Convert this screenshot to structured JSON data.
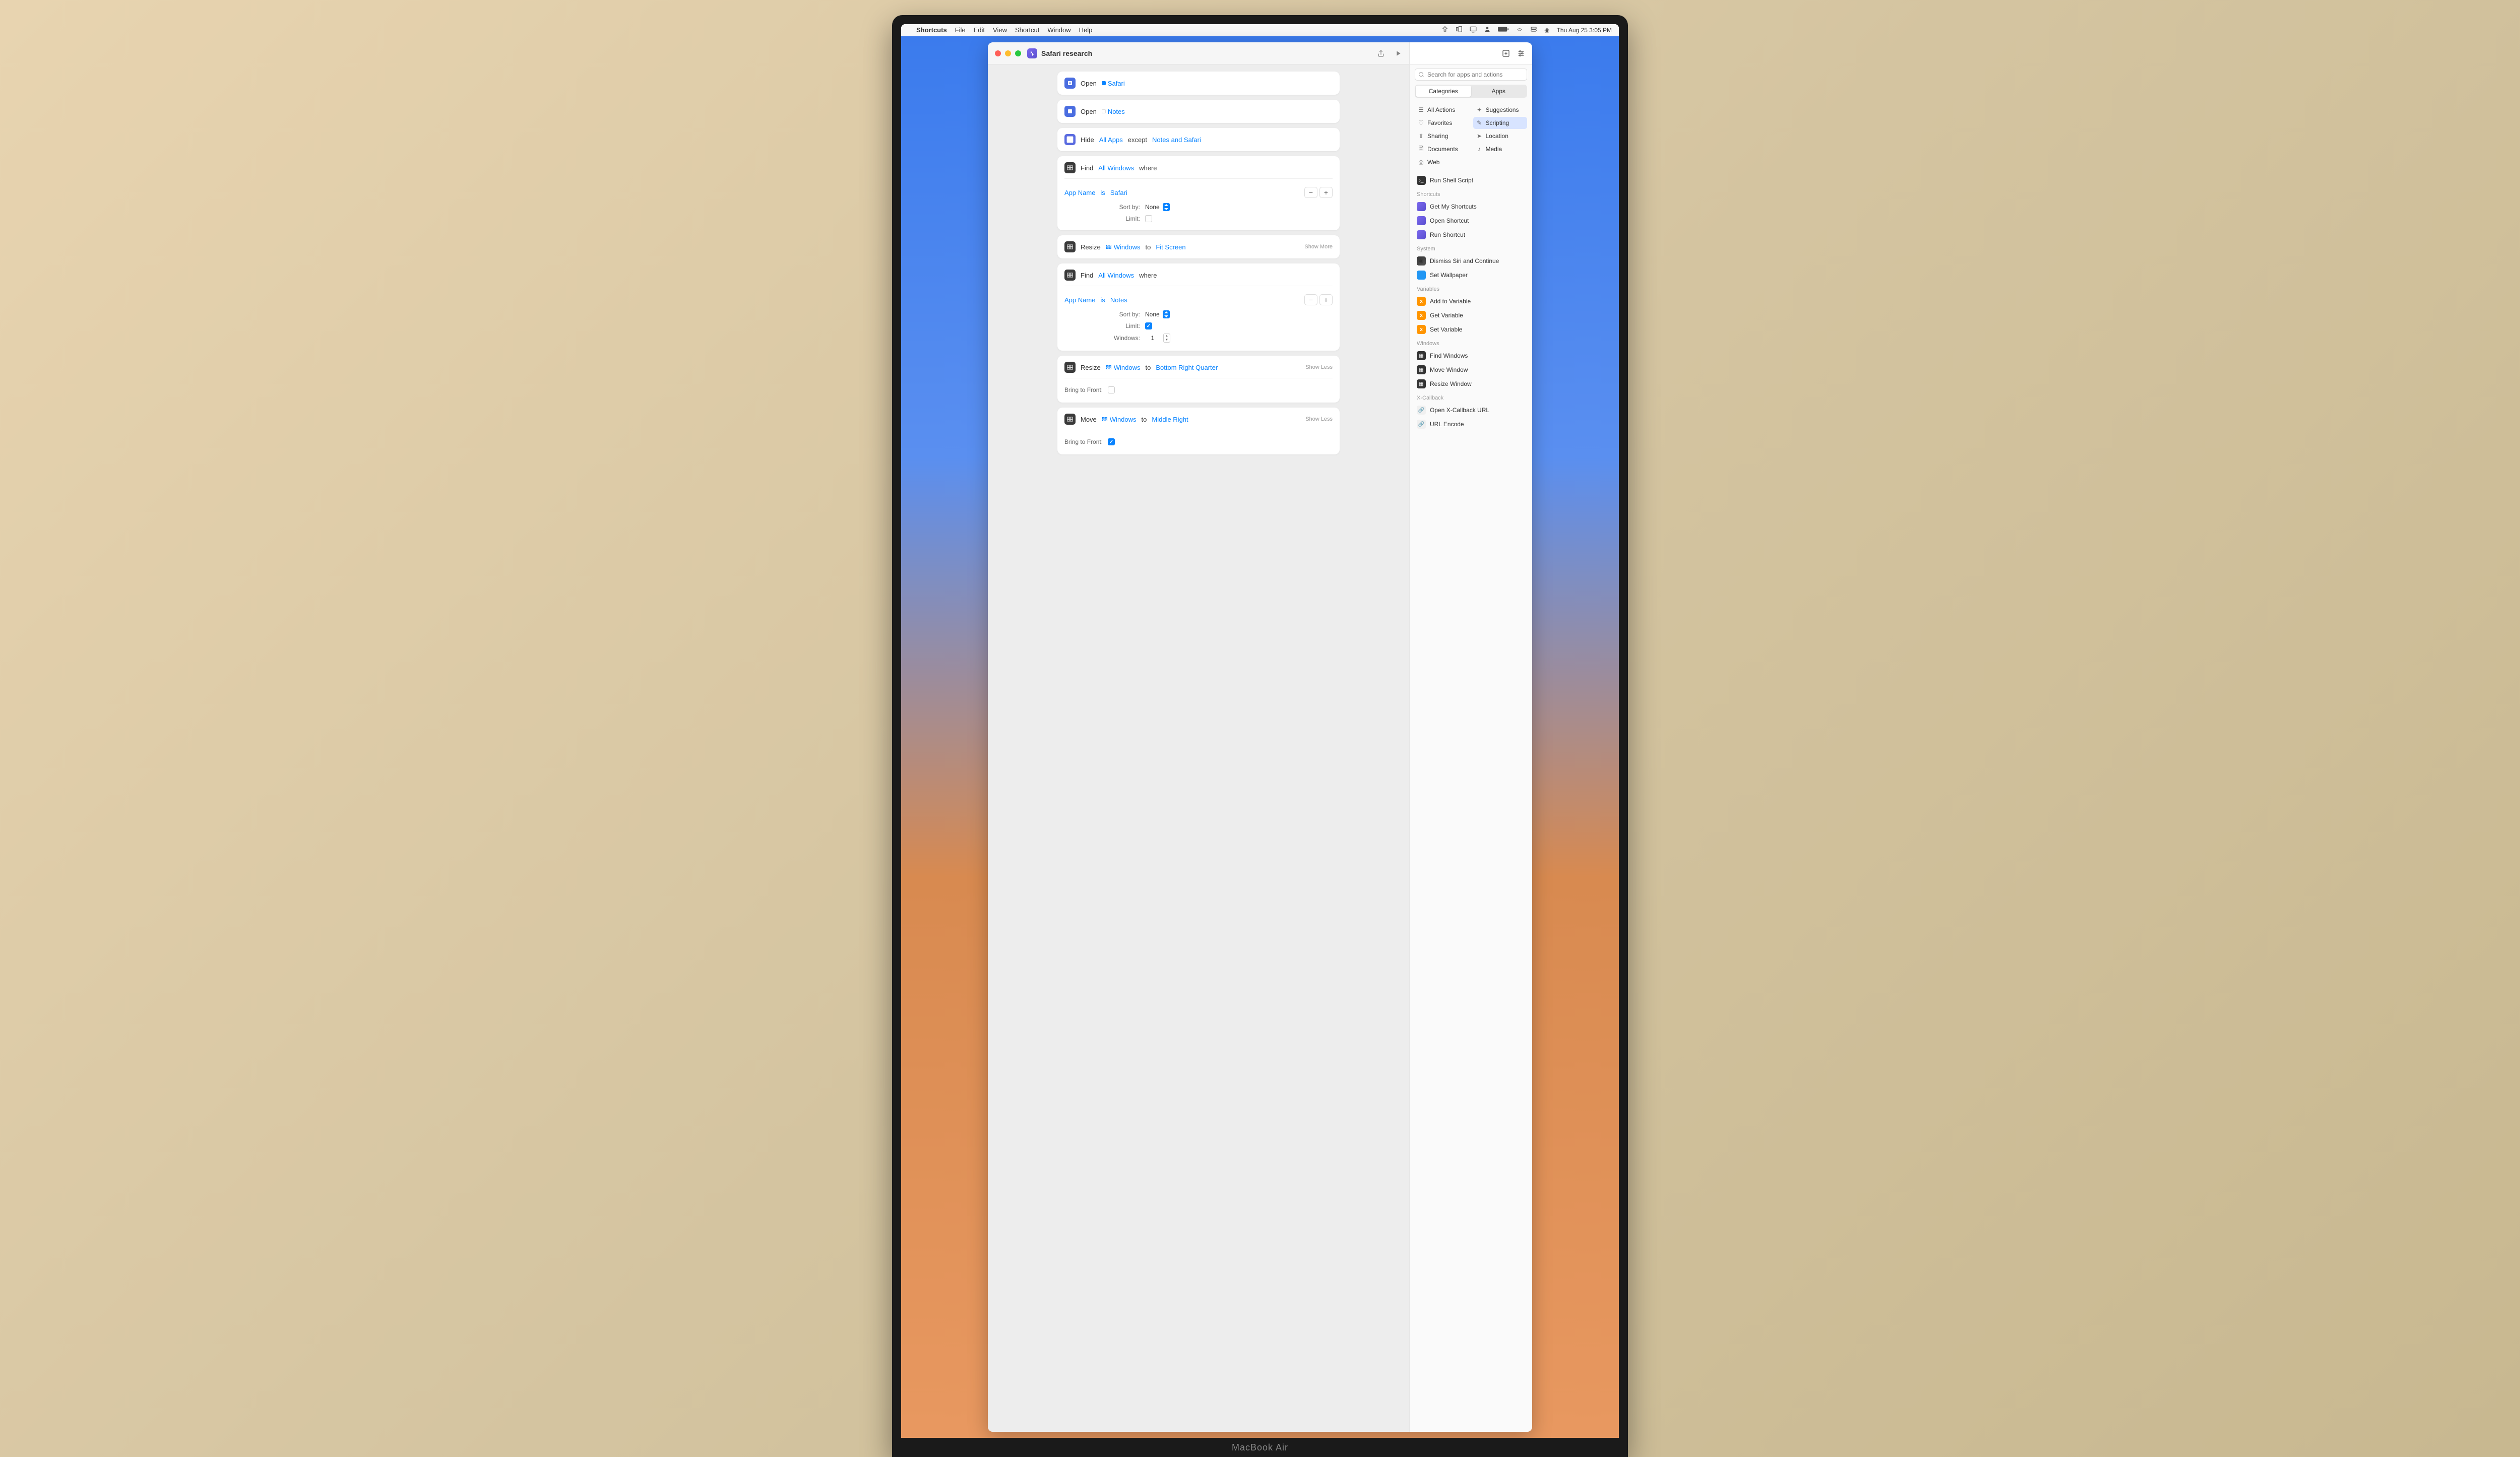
{
  "menubar": {
    "app": "Shortcuts",
    "items": [
      "File",
      "Edit",
      "View",
      "Shortcut",
      "Window",
      "Help"
    ],
    "clock": "Thu Aug 25  3:05 PM"
  },
  "window": {
    "title": "Safari research"
  },
  "editor": {
    "open1": {
      "action": "Open",
      "target": "Safari"
    },
    "open2": {
      "action": "Open",
      "target": "Notes"
    },
    "hide": {
      "action": "Hide",
      "scope": "All Apps",
      "except": "except",
      "targets": "Notes and Safari"
    },
    "find1": {
      "action": "Find",
      "scope": "All Windows",
      "where": "where",
      "field": "App Name",
      "op": "is",
      "value": "Safari",
      "sortLabel": "Sort by:",
      "sortValue": "None",
      "limitLabel": "Limit:",
      "limitChecked": false
    },
    "resize1": {
      "action": "Resize",
      "target": "Windows",
      "to": "to",
      "value": "Fit Screen",
      "more": "Show More"
    },
    "find2": {
      "action": "Find",
      "scope": "All Windows",
      "where": "where",
      "field": "App Name",
      "op": "is",
      "value": "Notes",
      "sortLabel": "Sort by:",
      "sortValue": "None",
      "limitLabel": "Limit:",
      "limitChecked": true,
      "windowsLabel": "Windows:",
      "windowsValue": "1"
    },
    "resize2": {
      "action": "Resize",
      "target": "Windows",
      "to": "to",
      "value": "Bottom Right Quarter",
      "more": "Show Less",
      "btfLabel": "Bring to Front:",
      "btfChecked": false
    },
    "move1": {
      "action": "Move",
      "target": "Windows",
      "to": "to",
      "value": "Middle Right",
      "more": "Show Less",
      "btfLabel": "Bring to Front:",
      "btfChecked": true
    }
  },
  "sidebar": {
    "searchPlaceholder": "Search for apps and actions",
    "seg": {
      "left": "Categories",
      "right": "Apps"
    },
    "cats": {
      "allActions": "All Actions",
      "suggestions": "Suggestions",
      "favorites": "Favorites",
      "scripting": "Scripting",
      "sharing": "Sharing",
      "location": "Location",
      "documents": "Documents",
      "media": "Media",
      "web": "Web"
    },
    "sections": {
      "topItem": "Run Shell Script",
      "shortcuts": {
        "h": "Shortcuts",
        "items": [
          "Get My Shortcuts",
          "Open Shortcut",
          "Run Shortcut"
        ]
      },
      "system": {
        "h": "System",
        "items": [
          "Dismiss Siri and Continue",
          "Set Wallpaper"
        ]
      },
      "variables": {
        "h": "Variables",
        "items": [
          "Add to Variable",
          "Get Variable",
          "Set Variable"
        ]
      },
      "windows": {
        "h": "Windows",
        "items": [
          "Find Windows",
          "Move Window",
          "Resize Window"
        ]
      },
      "xcallback": {
        "h": "X-Callback",
        "items": [
          "Open X-Callback URL",
          "URL Encode"
        ]
      }
    }
  },
  "chin": "MacBook Air"
}
